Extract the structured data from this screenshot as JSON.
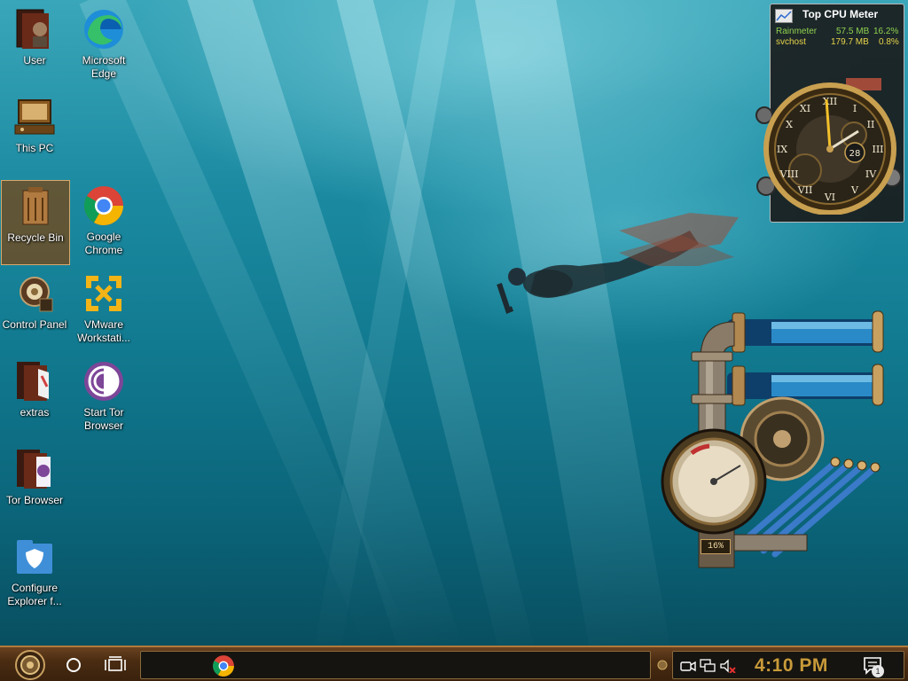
{
  "desktop": {
    "icons": [
      {
        "label": "User",
        "icon": "user-folder-icon"
      },
      {
        "label": "Microsoft Edge",
        "icon": "edge-icon"
      },
      {
        "label": "This PC",
        "icon": "computer-icon"
      },
      {
        "label": "Recycle Bin",
        "icon": "recycle-bin-icon"
      },
      {
        "label": "Google Chrome",
        "icon": "chrome-icon"
      },
      {
        "label": "Control Panel",
        "icon": "control-panel-icon"
      },
      {
        "label": "VMware Workstati...",
        "icon": "vmware-icon"
      },
      {
        "label": "extras",
        "icon": "folder-icon"
      },
      {
        "label": "Start Tor Browser",
        "icon": "tor-icon"
      },
      {
        "label": "Tor Browser",
        "icon": "tor-folder-icon"
      },
      {
        "label": "Configure Explorer f...",
        "icon": "shield-folder-icon"
      }
    ]
  },
  "cpu_meter": {
    "title": "Top CPU Meter",
    "rows": [
      {
        "process": "Rainmeter",
        "memory": "57.5 MB",
        "cpu": "16.2%"
      },
      {
        "process": "svchost",
        "memory": "179.7 MB",
        "cpu": "0.8%"
      }
    ]
  },
  "clock_widget": {
    "date_number": "28"
  },
  "pipe_widget": {
    "cpu_percent_label": "16%"
  },
  "taskbar": {
    "time": "4:10 PM",
    "notification_count": "1"
  },
  "colors": {
    "accent": "#c89a3a",
    "taskbar": "#4a2c12",
    "meter_green": "#8fd14f",
    "meter_yellow": "#e8d44a"
  }
}
